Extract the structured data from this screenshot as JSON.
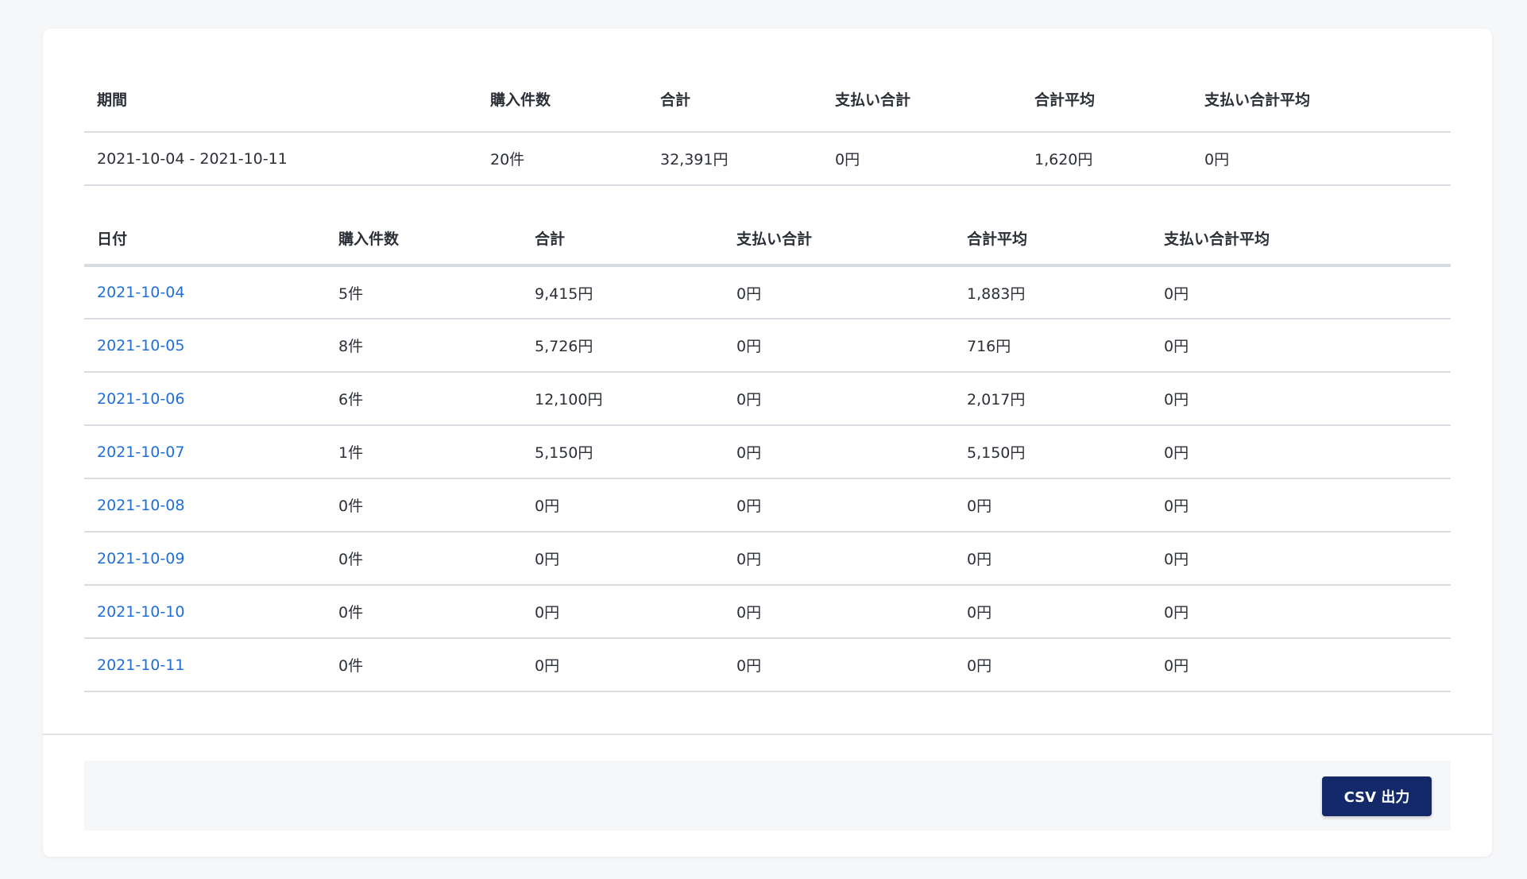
{
  "summary": {
    "headers": {
      "period": "期間",
      "count": "購入件数",
      "total": "合計",
      "paid_total": "支払い合計",
      "avg": "合計平均",
      "paid_avg": "支払い合計平均"
    },
    "row": {
      "period": "2021-10-04 - 2021-10-11",
      "count": "20件",
      "total": "32,391円",
      "paid_total": "0円",
      "avg": "1,620円",
      "paid_avg": "0円"
    }
  },
  "daily": {
    "headers": {
      "date": "日付",
      "count": "購入件数",
      "total": "合計",
      "paid_total": "支払い合計",
      "avg": "合計平均",
      "paid_avg": "支払い合計平均"
    },
    "rows": [
      {
        "date": "2021-10-04",
        "count": "5件",
        "total": "9,415円",
        "paid_total": "0円",
        "avg": "1,883円",
        "paid_avg": "0円"
      },
      {
        "date": "2021-10-05",
        "count": "8件",
        "total": "5,726円",
        "paid_total": "0円",
        "avg": "716円",
        "paid_avg": "0円"
      },
      {
        "date": "2021-10-06",
        "count": "6件",
        "total": "12,100円",
        "paid_total": "0円",
        "avg": "2,017円",
        "paid_avg": "0円"
      },
      {
        "date": "2021-10-07",
        "count": "1件",
        "total": "5,150円",
        "paid_total": "0円",
        "avg": "5,150円",
        "paid_avg": "0円"
      },
      {
        "date": "2021-10-08",
        "count": "0件",
        "total": "0円",
        "paid_total": "0円",
        "avg": "0円",
        "paid_avg": "0円"
      },
      {
        "date": "2021-10-09",
        "count": "0件",
        "total": "0円",
        "paid_total": "0円",
        "avg": "0円",
        "paid_avg": "0円"
      },
      {
        "date": "2021-10-10",
        "count": "0件",
        "total": "0円",
        "paid_total": "0円",
        "avg": "0円",
        "paid_avg": "0円"
      },
      {
        "date": "2021-10-11",
        "count": "0件",
        "total": "0円",
        "paid_total": "0円",
        "avg": "0円",
        "paid_avg": "0円"
      }
    ]
  },
  "footer": {
    "csv_label": "CSV 出力"
  },
  "colors": {
    "link": "#1f6fd6",
    "button_bg": "#13296a",
    "divider": "#d9dce1",
    "page_bg": "#f6f7f9"
  }
}
